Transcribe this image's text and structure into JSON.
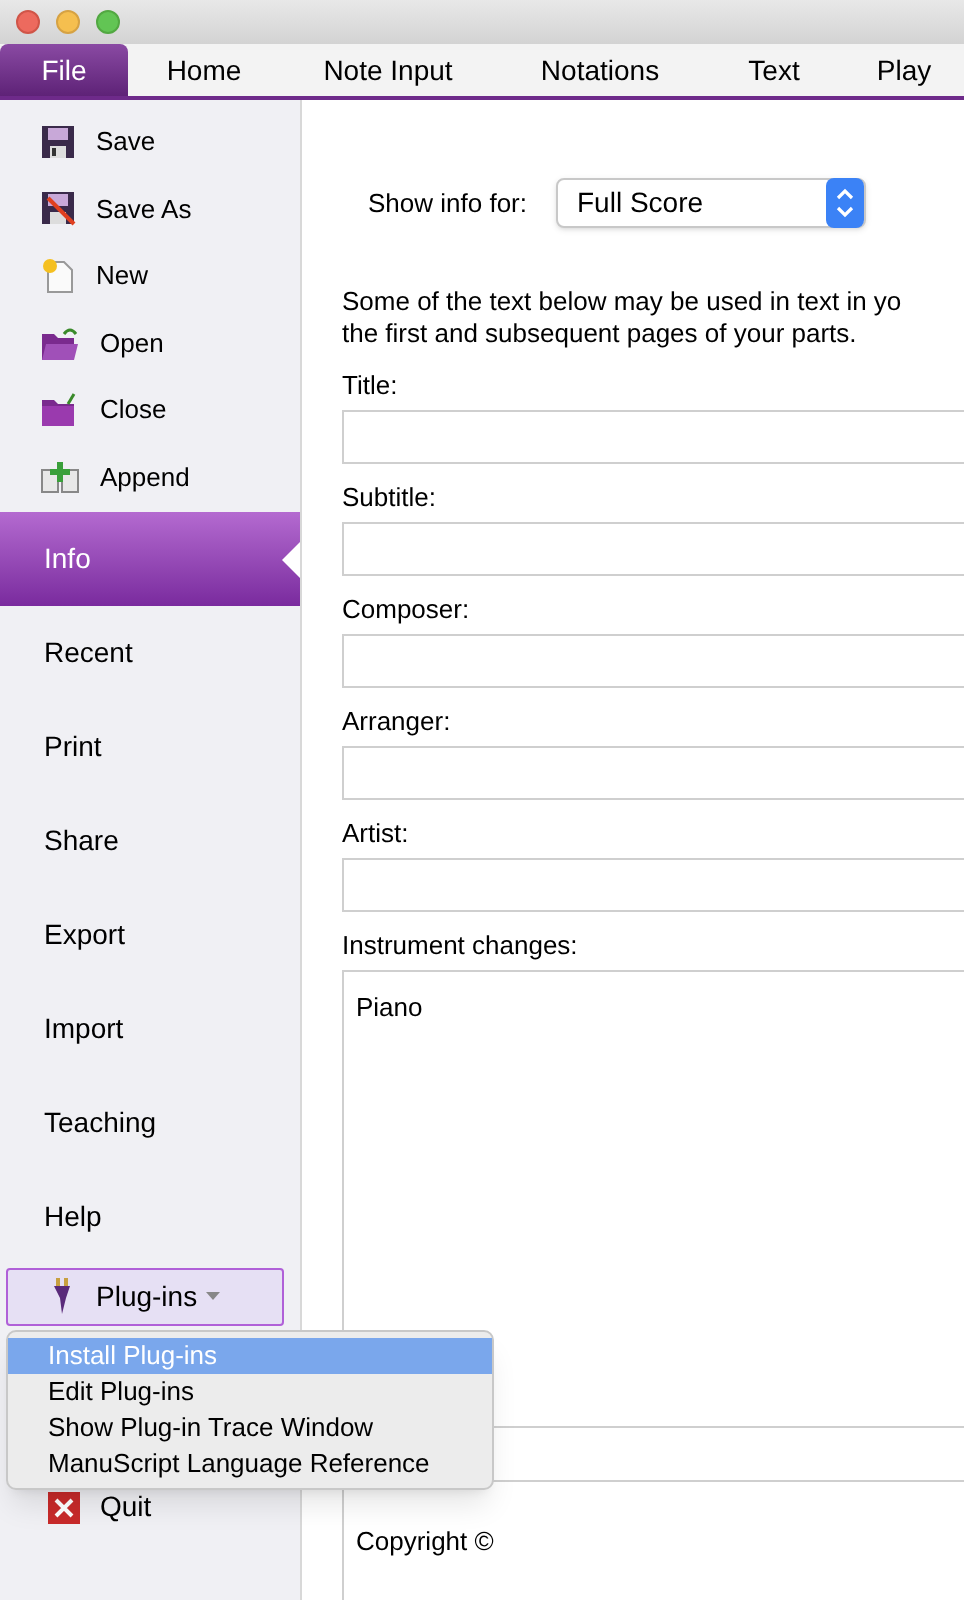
{
  "tabs": [
    {
      "label": "File",
      "selected": true
    },
    {
      "label": "Home",
      "selected": false
    },
    {
      "label": "Note Input",
      "selected": false
    },
    {
      "label": "Notations",
      "selected": false
    },
    {
      "label": "Text",
      "selected": false
    },
    {
      "label": "Play",
      "selected": false
    }
  ],
  "sidebar": {
    "commands": [
      {
        "label": "Save"
      },
      {
        "label": "Save As"
      },
      {
        "label": "New"
      },
      {
        "label": "Open"
      },
      {
        "label": "Close"
      },
      {
        "label": "Append"
      }
    ],
    "sections": [
      {
        "label": "Info",
        "selected": true
      },
      {
        "label": "Recent",
        "selected": false
      },
      {
        "label": "Print",
        "selected": false
      },
      {
        "label": "Share",
        "selected": false
      },
      {
        "label": "Export",
        "selected": false
      },
      {
        "label": "Import",
        "selected": false
      },
      {
        "label": "Teaching",
        "selected": false
      },
      {
        "label": "Help",
        "selected": false
      }
    ],
    "plugins_button": {
      "label": "Plug-ins"
    },
    "quit": {
      "label": "Quit"
    }
  },
  "plugins_menu": [
    {
      "label": "Install Plug-ins",
      "selected": true
    },
    {
      "label": "Edit Plug-ins",
      "selected": false
    },
    {
      "label": "Show Plug-in Trace Window",
      "selected": false
    },
    {
      "label": "ManuScript Language Reference",
      "selected": false
    }
  ],
  "info": {
    "show_info_for": {
      "label": "Show info for:",
      "value": "Full Score"
    },
    "note_lines": [
      "Some of the text below may be used in text in yo",
      "the first and subsequent pages of your parts."
    ],
    "fields": [
      {
        "label": "Title:"
      },
      {
        "label": "Subtitle:"
      },
      {
        "label": "Composer:"
      },
      {
        "label": "Arranger:"
      },
      {
        "label": "Artist:"
      }
    ],
    "instrument_changes": {
      "label": "Instrument changes:",
      "value": "Piano"
    },
    "copyright": {
      "value": "Copyright ©"
    }
  }
}
